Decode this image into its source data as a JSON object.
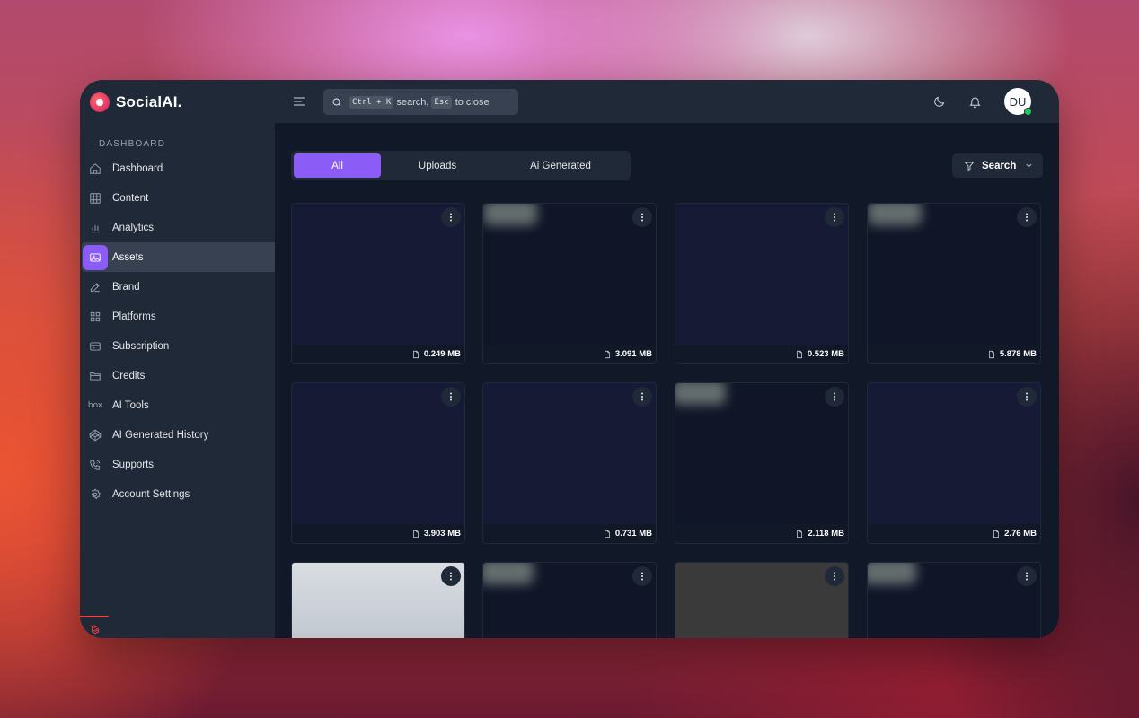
{
  "app": {
    "name": "SocialAI."
  },
  "sidebar": {
    "section": "DASHBOARD",
    "items": [
      {
        "label": "Dashboard",
        "icon": "home-icon"
      },
      {
        "label": "Content",
        "icon": "grid-icon"
      },
      {
        "label": "Analytics",
        "icon": "bar-chart-icon"
      },
      {
        "label": "Assets",
        "icon": "image-icon",
        "active": true
      },
      {
        "label": "Brand",
        "icon": "edit-icon"
      },
      {
        "label": "Platforms",
        "icon": "apps-icon"
      },
      {
        "label": "Subscription",
        "icon": "card-icon"
      },
      {
        "label": "Credits",
        "icon": "folder-icon"
      },
      {
        "label": "AI Tools",
        "icon": "box-icon"
      },
      {
        "label": "AI Generated History",
        "icon": "codepen-icon"
      },
      {
        "label": "Supports",
        "icon": "phone-icon"
      },
      {
        "label": "Account Settings",
        "icon": "gear-icon"
      }
    ],
    "box_text": "box"
  },
  "header": {
    "search_kbd1": "Ctrl + K",
    "search_text1": "search,",
    "search_kbd2": "Esc",
    "search_text2": "to close",
    "avatar": "DU"
  },
  "tabs": [
    {
      "label": "All",
      "active": true
    },
    {
      "label": "Uploads"
    },
    {
      "label": "Ai Generated"
    }
  ],
  "filter": {
    "label": "Search"
  },
  "assets": [
    {
      "size": "0.249 MB"
    },
    {
      "size": "3.091 MB"
    },
    {
      "size": "0.523 MB"
    },
    {
      "size": "5.878 MB"
    },
    {
      "size": "3.903 MB"
    },
    {
      "size": "0.731 MB"
    },
    {
      "size": "2.118 MB"
    },
    {
      "size": "2.76 MB"
    },
    {
      "size": ""
    },
    {
      "size": ""
    },
    {
      "size": ""
    },
    {
      "size": ""
    }
  ],
  "colors": {
    "accent": "#8b5cf6",
    "online": "#22c55e",
    "panel": "#1f2937",
    "main_bg": "#111827"
  }
}
